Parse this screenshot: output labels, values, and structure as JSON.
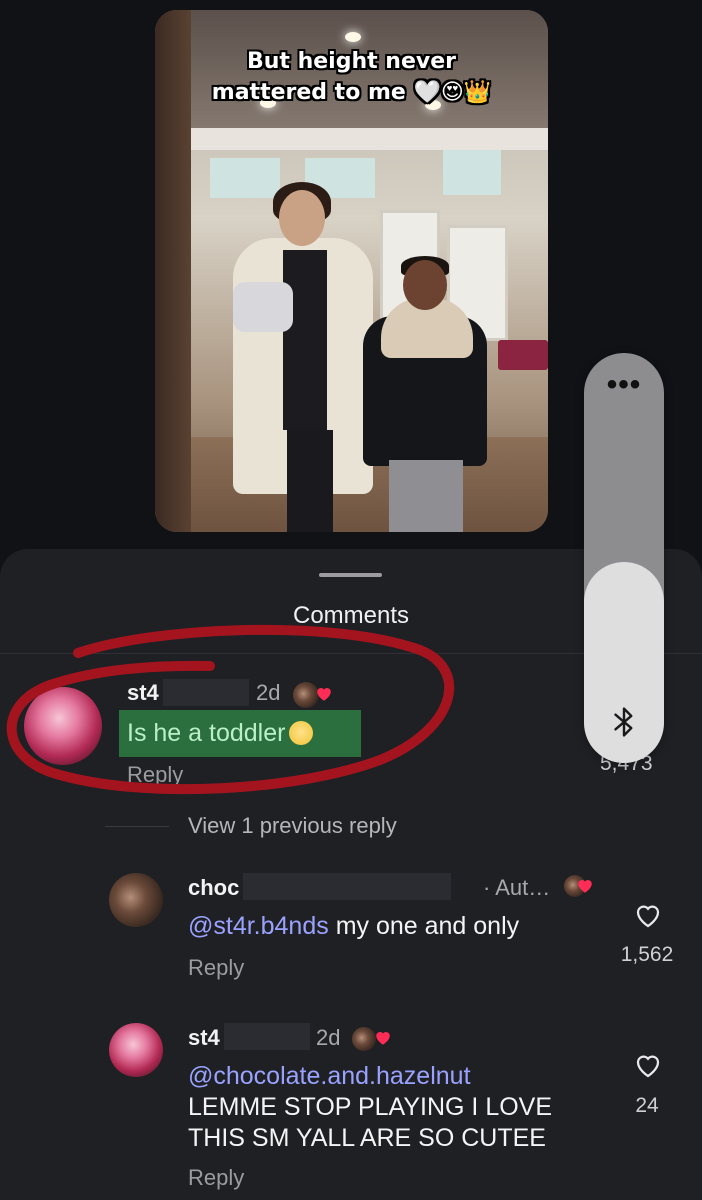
{
  "video": {
    "caption_line1": "But height never",
    "caption_line2": "mattered to me 🤍😍👑"
  },
  "sheet": {
    "title": "Comments"
  },
  "comments": [
    {
      "username": "st4",
      "age": "2d",
      "text": "Is he a toddler",
      "reply_label": "Reply",
      "like_count": "5,473"
    }
  ],
  "view_previous": "View 1 previous reply",
  "replies": [
    {
      "username": "choc",
      "age": "· Aut…",
      "mention": "@st4r.b4nds",
      "text": " my one and only",
      "reply_label": "Reply",
      "like_count": "1,562"
    },
    {
      "username": "st4",
      "age": "2d",
      "mention": "@chocolate.and.hazelnut",
      "text_line1": "LEMME STOP PLAYING I LOVE",
      "text_line2": "THIS SM YALL ARE SO CUTEE",
      "reply_label": "Reply",
      "like_count": "24"
    }
  ],
  "volume_hud": {
    "menu_icon": "more-dots-icon",
    "output_icon": "bluetooth-icon",
    "level": 0.49
  },
  "colors": {
    "sheet_bg": "#1f2024",
    "mention": "#9aa2ff",
    "highlight": "#2c6f3f",
    "annotation_red": "#a3141e"
  }
}
